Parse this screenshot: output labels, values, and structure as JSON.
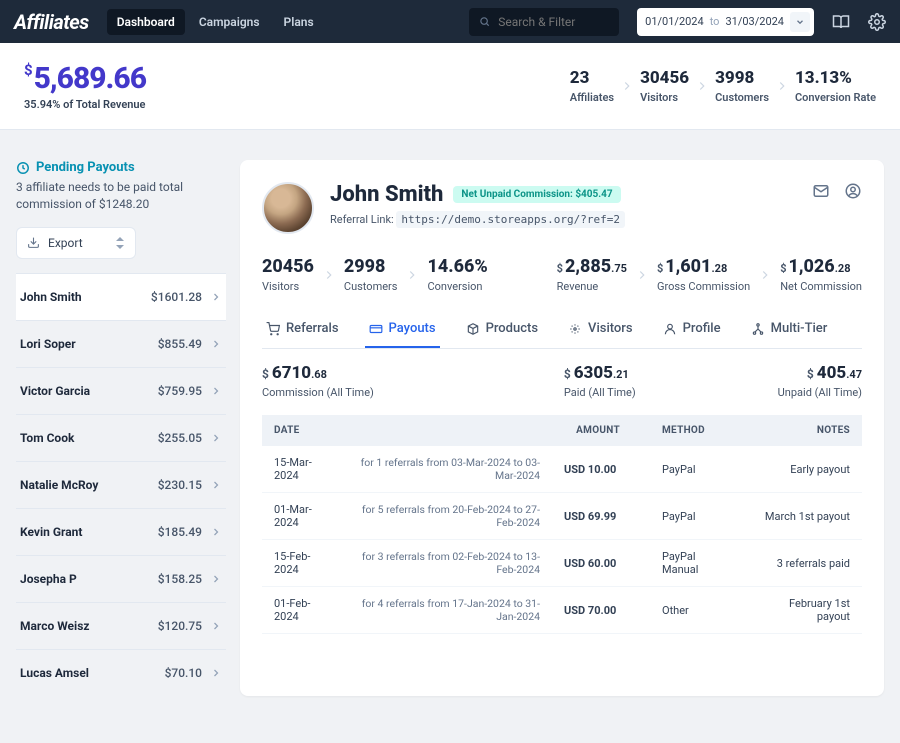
{
  "brand": "Affiliates",
  "nav": {
    "dashboard": "Dashboard",
    "campaigns": "Campaigns",
    "plans": "Plans"
  },
  "search": {
    "placeholder": "Search & Filter"
  },
  "dateRange": {
    "from": "01/01/2024",
    "to_label": "to",
    "to": "31/03/2024"
  },
  "summary": {
    "currency": "$",
    "amount": "5,689.66",
    "sub": "35.94% of Total Revenue",
    "kpis": [
      {
        "v": "23",
        "l": "Affiliates"
      },
      {
        "v": "30456",
        "l": "Visitors"
      },
      {
        "v": "3998",
        "l": "Customers"
      },
      {
        "v": "13.13%",
        "l": "Conversion Rate"
      }
    ]
  },
  "pending": {
    "title": "Pending Payouts",
    "text": "3 affiliate needs to be paid total commission of $1248.20"
  },
  "export_label": "Export",
  "affiliates": [
    {
      "name": "John Smith",
      "amount": "$1601.28"
    },
    {
      "name": "Lori Soper",
      "amount": "$855.49"
    },
    {
      "name": "Victor Garcia",
      "amount": "$759.95"
    },
    {
      "name": "Tom Cook",
      "amount": "$255.05"
    },
    {
      "name": "Natalie McRoy",
      "amount": "$230.15"
    },
    {
      "name": "Kevin Grant",
      "amount": "$185.49"
    },
    {
      "name": "Josepha P",
      "amount": "$158.25"
    },
    {
      "name": "Marco Weisz",
      "amount": "$120.75"
    },
    {
      "name": "Lucas Amsel",
      "amount": "$70.10"
    }
  ],
  "profile": {
    "name": "John Smith",
    "badge": "Net Unpaid Commission: $405.47",
    "reflabel": "Referral Link:",
    "refurl": "https://demo.storeapps.org/?ref=2"
  },
  "stats": [
    {
      "v": "20456",
      "l": "Visitors"
    },
    {
      "v": "2998",
      "l": "Customers"
    },
    {
      "v": "14.66%",
      "l": "Conversion"
    },
    {
      "cur": "$",
      "v": "2,885",
      "dec": ".75",
      "l": "Revenue"
    },
    {
      "cur": "$",
      "v": "1,601",
      "dec": ".28",
      "l": "Gross Commission"
    },
    {
      "cur": "$",
      "v": "1,026",
      "dec": ".28",
      "l": "Net Commission"
    }
  ],
  "tabs": {
    "referrals": "Referrals",
    "payouts": "Payouts",
    "products": "Products",
    "visitors": "Visitors",
    "profile": "Profile",
    "multitier": "Multi-Tier"
  },
  "totals": [
    {
      "cur": "$",
      "v": "6710",
      "dec": ".68",
      "l": "Commission (All Time)"
    },
    {
      "cur": "$",
      "v": "6305",
      "dec": ".21",
      "l": "Paid (All Time)"
    },
    {
      "cur": "$",
      "v": "405",
      "dec": ".47",
      "l": "Unpaid (All Time)"
    }
  ],
  "table": {
    "headers": {
      "date": "DATE",
      "amount": "AMOUNT",
      "method": "METHOD",
      "notes": "NOTES"
    },
    "rows": [
      {
        "date": "15-Mar-2024",
        "desc": "for 1 referrals from 03-Mar-2024 to 03-Mar-2024",
        "amount": "USD 10.00",
        "method": "PayPal",
        "notes": "Early payout"
      },
      {
        "date": "01-Mar-2024",
        "desc": "for 5 referrals from 20-Feb-2024 to 27-Feb-2024",
        "amount": "USD 69.99",
        "method": "PayPal",
        "notes": "March 1st payout"
      },
      {
        "date": "15-Feb-2024",
        "desc": "for 3 referrals from 02-Feb-2024 to 13-Feb-2024",
        "amount": "USD 60.00",
        "method": "PayPal Manual",
        "notes": "3 referrals paid"
      },
      {
        "date": "01-Feb-2024",
        "desc": "for 4 referrals from 17-Jan-2024 to 31-Jan-2024",
        "amount": "USD 70.00",
        "method": "Other",
        "notes": "February 1st payout"
      }
    ]
  }
}
